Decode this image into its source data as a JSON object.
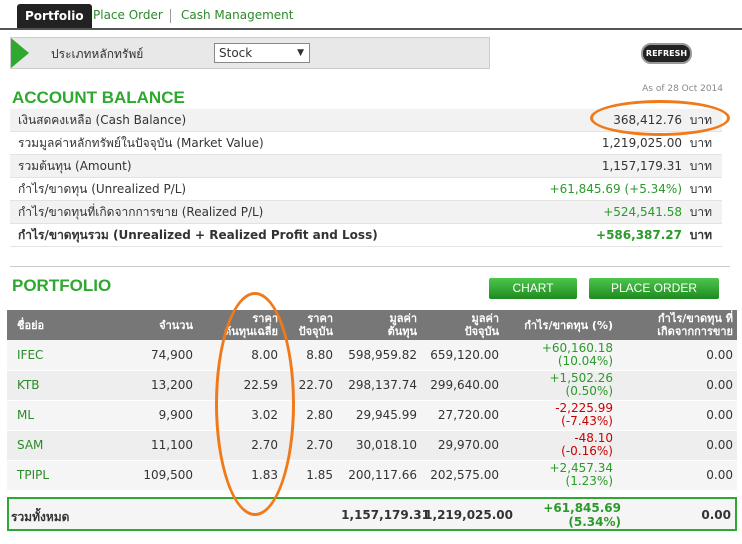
{
  "tabs": {
    "portfolio": "Portfolio",
    "place_order": "Place Order",
    "cash_management": "Cash Management"
  },
  "filter": {
    "label": "ประเภทหลักทรัพย์",
    "selected": "Stock"
  },
  "refresh_label": "REFRESH",
  "account": {
    "title": "ACCOUNT BALANCE",
    "as_of": "As of 28 Oct 2014",
    "rows": [
      {
        "label": "เงินสดคงเหลือ (Cash Balance)",
        "value": "368,412.76",
        "unit": "บาท"
      },
      {
        "label": "รวมมูลค่าหลักทรัพย์ในปัจจุบัน (Market Value)",
        "value": "1,219,025.00",
        "unit": "บาท"
      },
      {
        "label": "รวมต้นทุน (Amount)",
        "value": "1,157,179.31",
        "unit": "บาท"
      },
      {
        "label": "กำไร/ขาดทุน (Unrealized P/L)",
        "value": "+61,845.69 (+5.34%)",
        "unit": "บาท"
      },
      {
        "label": "กำไร/ขาดทุนที่เกิดจากการขาย (Realized P/L)",
        "value": "+524,541.58",
        "unit": "บาท"
      },
      {
        "label": "กำไร/ขาดทุนรวม (Unrealized + Realized Profit and Loss)",
        "value": "+586,387.27",
        "unit": "บาท"
      }
    ]
  },
  "portfolio": {
    "title": "PORTFOLIO",
    "chart_label": "CHART",
    "place_order_label": "PLACE ORDER",
    "headers": {
      "symbol": "ชื่อย่อ",
      "volume": "จำนวน",
      "avg_cost_1": "ราคา",
      "avg_cost_2": "ต้นทุนเฉลี่ย",
      "price_1": "ราคา",
      "price_2": "ปัจจุบัน",
      "cost_1": "มูลค่า",
      "cost_2": "ต้นทุน",
      "market_1": "มูลค่า",
      "market_2": "ปัจจุบัน",
      "upl": "กำไร/ขาดทุน (%)",
      "rpl_1": "กำไร/ขาดทุน ที่",
      "rpl_2": "เกิดจากการขาย"
    },
    "rows": [
      {
        "symbol": "IFEC",
        "volume": "74,900",
        "avg_cost": "8.00",
        "price": "8.80",
        "cost": "598,959.82",
        "market": "659,120.00",
        "pl": "+60,160.18",
        "pct": "(10.04%)",
        "rpl": "0.00"
      },
      {
        "symbol": "KTB",
        "volume": "13,200",
        "avg_cost": "22.59",
        "price": "22.70",
        "cost": "298,137.74",
        "market": "299,640.00",
        "pl": "+1,502.26",
        "pct": "(0.50%)",
        "rpl": "0.00"
      },
      {
        "symbol": "ML",
        "volume": "9,900",
        "avg_cost": "3.02",
        "price": "2.80",
        "cost": "29,945.99",
        "market": "27,720.00",
        "pl": "-2,225.99",
        "pct": "(-7.43%)",
        "rpl": "0.00"
      },
      {
        "symbol": "SAM",
        "volume": "11,100",
        "avg_cost": "2.70",
        "price": "2.70",
        "cost": "30,018.10",
        "market": "29,970.00",
        "pl": "-48.10",
        "pct": "(-0.16%)",
        "rpl": "0.00"
      },
      {
        "symbol": "TPIPL",
        "volume": "109,500",
        "avg_cost": "1.83",
        "price": "1.85",
        "cost": "200,117.66",
        "market": "202,575.00",
        "pl": "+2,457.34",
        "pct": "(1.23%)",
        "rpl": "0.00"
      }
    ],
    "total": {
      "label": "รวมทั้งหมด",
      "cost": "1,157,179.31",
      "market": "1,219,025.00",
      "pl": "+61,845.69",
      "pct": "(5.34%)",
      "rpl": "0.00"
    }
  },
  "colors": {
    "accent_green": "#2ea82e",
    "annotation_orange": "#f07a1a",
    "loss_red": "#cc0000"
  }
}
